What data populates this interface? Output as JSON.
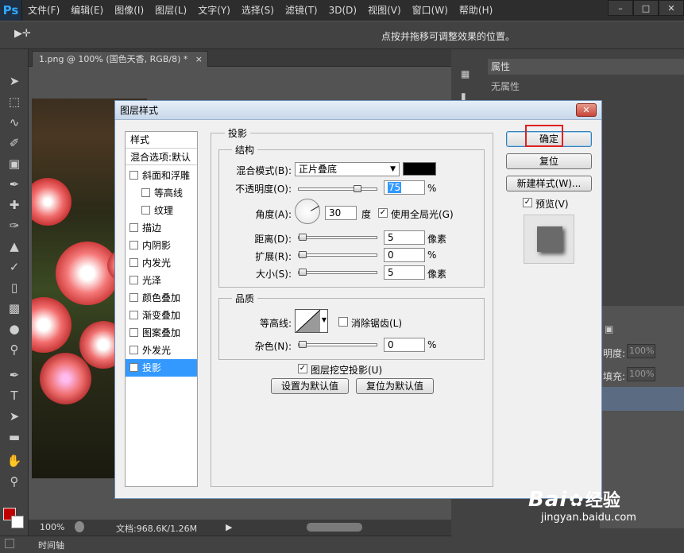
{
  "app": {
    "logo": "Ps",
    "menus": [
      "文件(F)",
      "编辑(E)",
      "图像(I)",
      "图层(L)",
      "文字(Y)",
      "选择(S)",
      "滤镜(T)",
      "3D(D)",
      "视图(V)",
      "窗口(W)",
      "帮助(H)"
    ],
    "window_buttons": [
      "–",
      "□",
      "✕"
    ]
  },
  "options_bar": {
    "tool_glyph": "▶✛",
    "hint": "点按并拖移可调整效果的位置。"
  },
  "document": {
    "tab_title": "1.png @ 100% (国色天香, RGB/8) *",
    "tab_close": "×"
  },
  "status": {
    "zoom": "100%",
    "doc_info": "文档:968.6K/1.26M",
    "timeline": "时间轴"
  },
  "properties_panel": {
    "title": "属性",
    "empty_text": "无属性"
  },
  "layers_panel": {
    "opacity_label": "明度:",
    "opacity_value": "100%",
    "fill_label": "填充:",
    "fill_value": "100%"
  },
  "dialog": {
    "title": "图层样式",
    "close": "✕",
    "styles_header": "样式",
    "blend_options": "混合选项:默认",
    "styles": [
      {
        "label": "斜面和浮雕",
        "checked": false,
        "sub": false
      },
      {
        "label": "等高线",
        "checked": false,
        "sub": true
      },
      {
        "label": "纹理",
        "checked": false,
        "sub": true
      },
      {
        "label": "描边",
        "checked": false,
        "sub": false
      },
      {
        "label": "内阴影",
        "checked": false,
        "sub": false
      },
      {
        "label": "内发光",
        "checked": false,
        "sub": false
      },
      {
        "label": "光泽",
        "checked": false,
        "sub": false
      },
      {
        "label": "颜色叠加",
        "checked": false,
        "sub": false
      },
      {
        "label": "渐变叠加",
        "checked": false,
        "sub": false
      },
      {
        "label": "图案叠加",
        "checked": false,
        "sub": false
      },
      {
        "label": "外发光",
        "checked": false,
        "sub": false
      },
      {
        "label": "投影",
        "checked": true,
        "sub": false,
        "active": true
      }
    ],
    "section_title": "投影",
    "structure": {
      "title": "结构",
      "blend_mode_label": "混合模式(B):",
      "blend_mode_value": "正片叠底",
      "shadow_color": "#000000",
      "opacity_label": "不透明度(O):",
      "opacity_value": "75",
      "opacity_unit": "%",
      "angle_label": "角度(A):",
      "angle_value": "30",
      "angle_unit": "度",
      "global_light_label": "使用全局光(G)",
      "global_light_checked": true,
      "distance_label": "距离(D):",
      "distance_value": "5",
      "distance_unit": "像素",
      "spread_label": "扩展(R):",
      "spread_value": "0",
      "spread_unit": "%",
      "size_label": "大小(S):",
      "size_value": "5",
      "size_unit": "像素"
    },
    "quality": {
      "title": "品质",
      "contour_label": "等高线:",
      "antialias_label": "消除锯齿(L)",
      "antialias_checked": false,
      "noise_label": "杂色(N):",
      "noise_value": "0",
      "noise_unit": "%"
    },
    "knockout_label": "图层挖空投影(U)",
    "knockout_checked": true,
    "make_default": "设置为默认值",
    "reset_default": "复位为默认值",
    "ok": "确定",
    "reset": "复位",
    "new_style": "新建样式(W)...",
    "preview_label": "预览(V)",
    "preview_checked": true
  },
  "watermark": {
    "brand": "Bai",
    "brand_end": "经验",
    "url": "jingyan.baidu.com"
  }
}
